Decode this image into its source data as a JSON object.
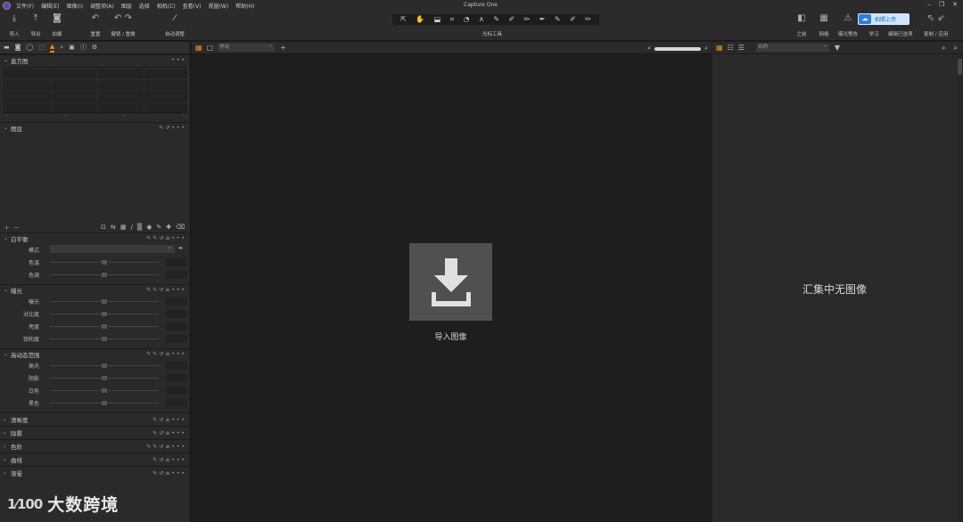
{
  "window": {
    "title": "Capture One",
    "controls": [
      "–",
      "❐",
      "✕"
    ]
  },
  "menu": [
    "文件(F)",
    "编辑(E)",
    "图像(I)",
    "调整项(A)",
    "图层",
    "选择",
    "相机(C)",
    "查看(V)",
    "视窗(W)",
    "帮助(H)"
  ],
  "toolbar": {
    "import": "导入",
    "export": "导出",
    "capture": "拍摄",
    "reset": "重置",
    "undo_redo": "撤销 / 重做",
    "auto_adjust": "自动调整",
    "cursor_tools_label": "光标工具",
    "before": "之前",
    "grid": "网格",
    "exposure_warning": "曝光警告",
    "learn": "学习",
    "edit_selected": "编辑已选项",
    "copy_apply": "复制 / 应用",
    "upload_badge": "拍照上传"
  },
  "cursor_tools": [
    "⇱",
    "✋",
    "⬓",
    "⌗",
    "◔",
    "∧",
    "✎",
    "✐",
    "✏",
    "✒",
    "✎",
    "✐",
    "✏"
  ],
  "left_panel": {
    "tool_tabs": [
      "▬",
      "◙",
      "◯",
      "⬚",
      "▲",
      "⌕",
      "▣",
      "ⓘ",
      "⚙"
    ],
    "histogram": {
      "title": "直方图",
      "dashes": [
        "--",
        "--",
        "--",
        "--"
      ]
    },
    "layers": {
      "title": "图层",
      "tools": [
        "⊡",
        "⇆",
        "▦",
        "/",
        "▒",
        "◉",
        "✎",
        "✚",
        "⌫"
      ]
    },
    "white_balance": {
      "title": "白平衡",
      "mode_label": "模式",
      "rows": [
        "色温",
        "色调"
      ]
    },
    "exposure": {
      "title": "曝光",
      "rows": [
        "曝光",
        "对比度",
        "亮度",
        "饱和度"
      ]
    },
    "hdr": {
      "title": "高动态范围",
      "rows": [
        "高光",
        "阴影",
        "白色",
        "黑色"
      ]
    },
    "collapsed": [
      "清晰度",
      "除雾",
      "色阶",
      "曲线",
      "渐晕"
    ]
  },
  "viewer": {
    "select_placeholder": "黑暗",
    "import_label": "导入图像"
  },
  "browser": {
    "sort_label": "名称",
    "empty_message": "汇集中无图像"
  },
  "watermark": {
    "logo": "1⁄100",
    "text": "大数跨境"
  },
  "colors": {
    "accent": "#f28c1b",
    "bg": "#1e1e1e",
    "panel": "#2a2a2a"
  }
}
